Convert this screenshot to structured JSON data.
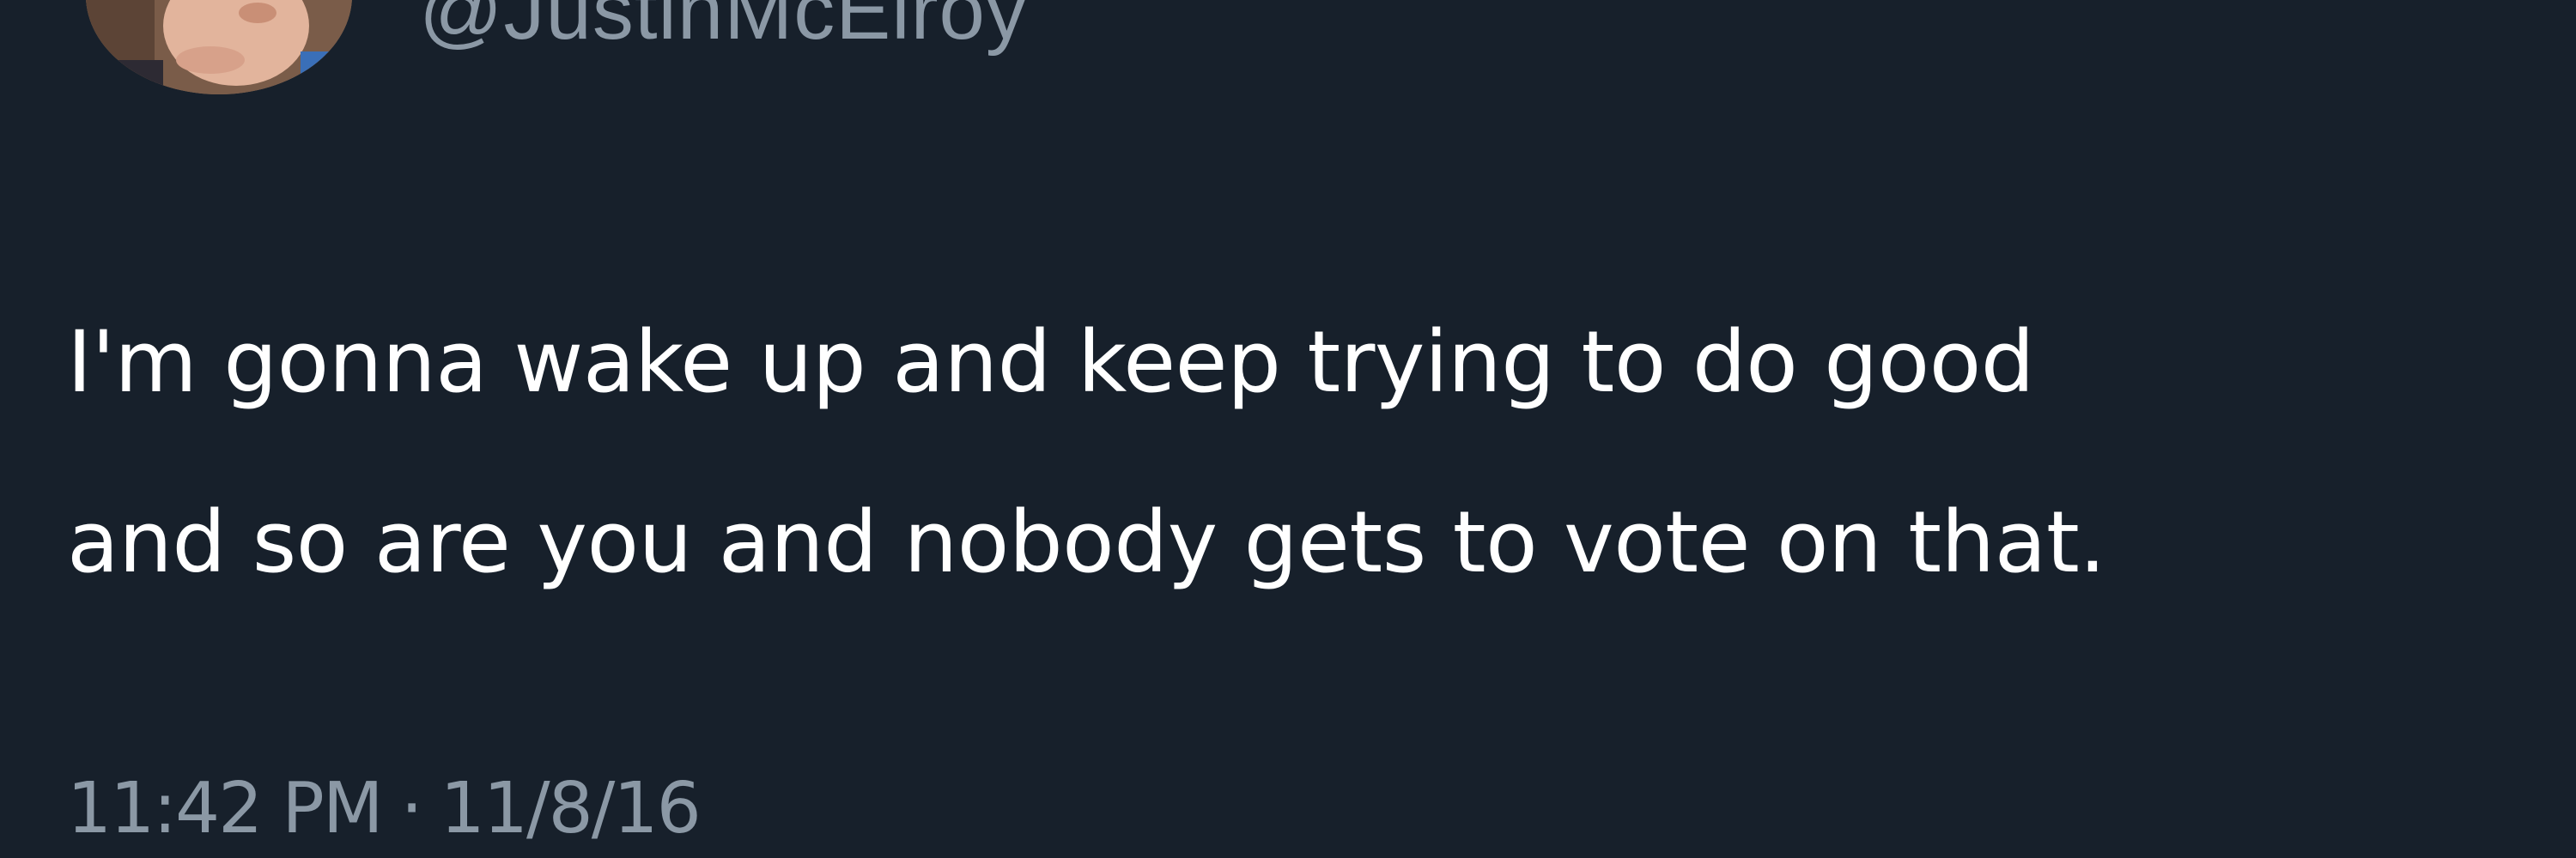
{
  "tweet": {
    "handle": "@JustinMcElroy",
    "text_lines": [
      "I'm gonna wake up and keep trying to do good",
      "and so are you and nobody gets to vote on that."
    ],
    "time": "11:42 PM",
    "separator": "·",
    "date": "11/8/16"
  },
  "colors": {
    "background": "#17202b",
    "text": "#ffffff",
    "secondary_text": "#8b98a5"
  },
  "icons": {
    "avatar": "profile-photo"
  }
}
